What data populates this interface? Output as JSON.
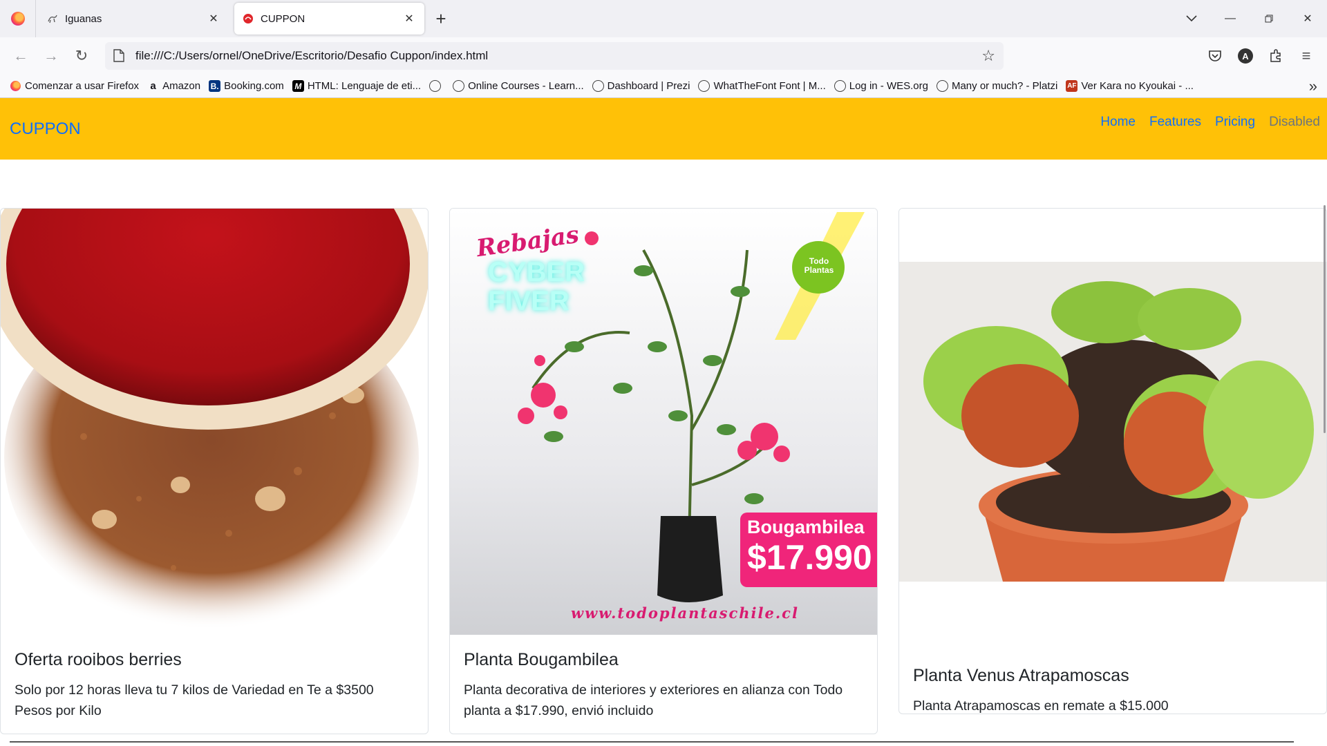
{
  "browser": {
    "tabs": [
      {
        "title": "Iguanas",
        "active": false,
        "icon": "iguana-favicon-icon"
      },
      {
        "title": "CUPPON",
        "active": true,
        "icon": "cuppon-favicon-icon"
      }
    ],
    "url": "file:///C:/Users/ornel/OneDrive/Escritorio/Desafio Cuppon/index.html",
    "bookmarks": [
      {
        "label": "Comenzar a usar Firefox",
        "icon": "firefox-icon"
      },
      {
        "label": "Amazon",
        "icon": "amazon-icon"
      },
      {
        "label": "Booking.com",
        "icon": "booking-icon"
      },
      {
        "label": "HTML: Lenguaje de eti...",
        "icon": "mdn-icon"
      },
      {
        "label": "",
        "icon": "globe-icon"
      },
      {
        "label": "Online Courses - Learn...",
        "icon": "globe-icon"
      },
      {
        "label": "Dashboard | Prezi",
        "icon": "globe-icon"
      },
      {
        "label": "WhatTheFont Font | M...",
        "icon": "globe-icon"
      },
      {
        "label": "Log in - WES.org",
        "icon": "globe-icon"
      },
      {
        "label": "Many or much? - Platzi",
        "icon": "globe-icon"
      },
      {
        "label": "Ver Kara no Kyoukai - ...",
        "icon": "animeflv-icon"
      }
    ]
  },
  "site": {
    "brand": "CUPPON",
    "nav": [
      {
        "label": "Home",
        "disabled": false
      },
      {
        "label": "Features",
        "disabled": false
      },
      {
        "label": "Pricing",
        "disabled": false
      },
      {
        "label": "Disabled",
        "disabled": true
      }
    ],
    "cards": [
      {
        "title": "Oferta rooibos berries",
        "text": "Solo por 12 horas lleva tu 7 kilos de Variedad en Te a $3500 Pesos por Kilo",
        "image": "rooibos-tea-image"
      },
      {
        "title": "Planta Bougambilea",
        "text": "Planta decorativa de interiores y exteriores en alianza con Todo planta a $17.990, envió incluido",
        "image": "bougainvillea-plant-image",
        "promo": {
          "headline_1": "Rebajas",
          "headline_2": "CYBER",
          "headline_3": "FIVER",
          "badge": "Todo Plantas",
          "product": "Bougambilea",
          "price": "$17.990",
          "site": "www.todoplantaschile.cl"
        }
      },
      {
        "title": "Planta Venus Atrapamoscas",
        "text": "Planta Atrapamoscas en remate a $15.000",
        "image": "venus-flytrap-image"
      }
    ]
  },
  "colors": {
    "navbar": "#ffc107",
    "link": "#0d6efd",
    "disabled": "#6c757d",
    "promo_pink": "#f0257a"
  }
}
